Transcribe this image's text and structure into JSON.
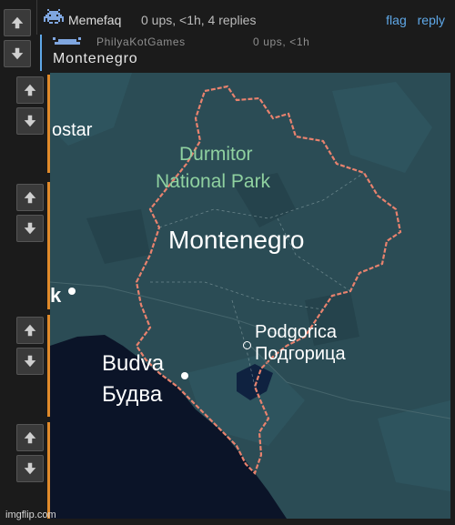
{
  "comment": {
    "username": "Memefaq",
    "meta": "0 ups, <1h, 4 replies",
    "actions": [
      "flag",
      "reply"
    ]
  },
  "reply": {
    "username": "PhilyaKotGames",
    "meta": "0 ups, <1h",
    "text": "Montenegro"
  },
  "map": {
    "labels": {
      "ostar": "ostar",
      "park_line1": "Durmitor",
      "park_line2": "National Park",
      "country": "Montenegro",
      "k": "k",
      "podgorica_latin": "Podgorica",
      "podgorica_cyrillic": "Подгорица",
      "budva_latin": "Budva",
      "budva_cyrillic": "Будва"
    }
  },
  "watermark": "imgflip.com",
  "colors": {
    "background": "#1b1b1b",
    "link": "#5fa8e8",
    "map_land": "#2c4d56",
    "map_sea": "#0b1428",
    "border": "#e8826e",
    "accent_bar": "#e08a2a",
    "park_text": "#8fd1a0"
  },
  "icons": {
    "vote_up": "up-arrow-icon",
    "vote_down": "down-arrow-icon",
    "avatar": "pixel-invader-icon"
  }
}
